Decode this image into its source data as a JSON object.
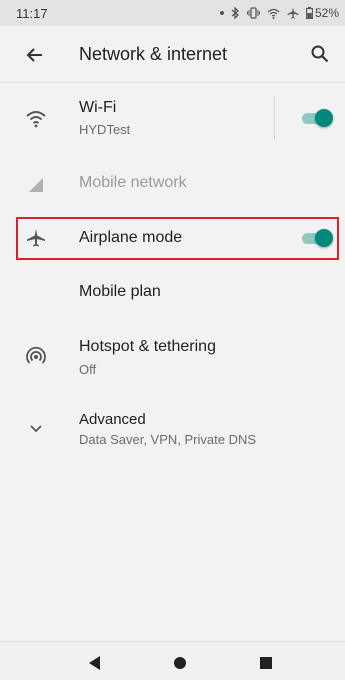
{
  "status_bar": {
    "time": "11:17",
    "battery": "52%",
    "icons": [
      "notification-dot-icon",
      "bluetooth-icon",
      "vibrate-icon",
      "wifi-icon",
      "airplane-icon",
      "battery-icon"
    ]
  },
  "toolbar": {
    "title": "Network & internet",
    "back_icon": "arrow-left-icon",
    "search_icon": "search-icon"
  },
  "items": [
    {
      "title": "Wi-Fi",
      "subtitle": "HYDTest",
      "icon": "wifi-icon",
      "toggle": true,
      "enabled": true
    },
    {
      "title": "Mobile network",
      "subtitle": "",
      "icon": "signal-icon",
      "enabled": false
    },
    {
      "title": "Airplane mode",
      "subtitle": "",
      "icon": "airplane-icon",
      "toggle": true,
      "enabled": true,
      "highlighted": true
    },
    {
      "title": "Mobile plan",
      "subtitle": "",
      "icon": "",
      "enabled": true
    },
    {
      "title": "Hotspot & tethering",
      "subtitle": "Off",
      "icon": "hotspot-icon",
      "enabled": true
    },
    {
      "title": "Advanced",
      "subtitle": "Data Saver, VPN, Private DNS",
      "icon": "chevron-down-icon",
      "enabled": true
    }
  ],
  "colors": {
    "accent": "#00897b",
    "accent_track": "#8fc9c0",
    "highlight_border": "#d9242b",
    "background": "#f2f2f2"
  },
  "nav_bar": {
    "icons": [
      "back-triangle-icon",
      "home-circle-icon",
      "recents-square-icon"
    ]
  }
}
